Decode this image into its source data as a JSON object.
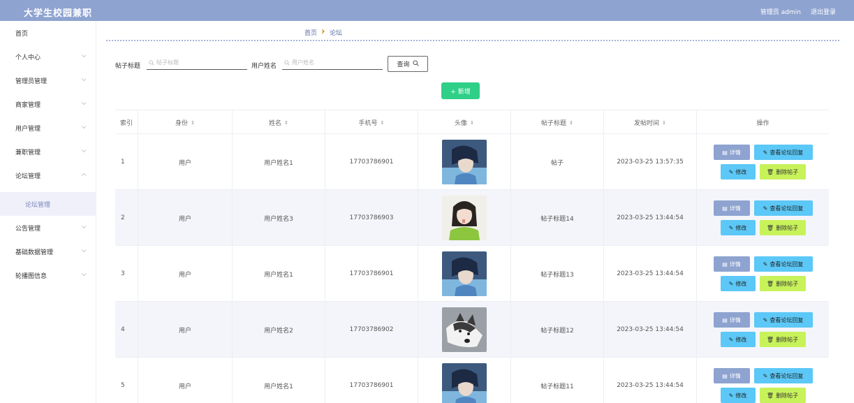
{
  "header": {
    "title": "大学生校园兼职",
    "user": "管理员 admin",
    "logout": "退出登录"
  },
  "sidebar": {
    "items": [
      {
        "label": "首页"
      },
      {
        "label": "个人中心"
      },
      {
        "label": "管理员管理"
      },
      {
        "label": "商家管理"
      },
      {
        "label": "用户管理"
      },
      {
        "label": "兼职管理"
      },
      {
        "label": "论坛管理"
      },
      {
        "label": "公告管理"
      },
      {
        "label": "基础数据管理"
      },
      {
        "label": "轮播图信息"
      }
    ],
    "active_sub": "论坛管理"
  },
  "breadcrumb": {
    "home": "首页",
    "current": "论坛"
  },
  "search": {
    "title_label": "帖子标题",
    "title_placeholder": "帖子标题",
    "user_label": "用户姓名",
    "user_placeholder": "用户姓名",
    "query_label": "查询"
  },
  "toolbar": {
    "add_label": "+ 新增"
  },
  "table": {
    "headers": [
      "索引",
      "身份",
      "姓名",
      "手机号",
      "头像",
      "帖子标题",
      "发帖时间",
      "操作"
    ],
    "rows": [
      {
        "index": "1",
        "role": "用户",
        "name": "用户姓名1",
        "phone": "17703786901",
        "avatar": "anime-boy",
        "title": "帖子",
        "time": "2023-03-25 13:57:35"
      },
      {
        "index": "2",
        "role": "用户",
        "name": "用户姓名3",
        "phone": "17703786903",
        "avatar": "girl-photo",
        "title": "帖子标题14",
        "time": "2023-03-25 13:44:54"
      },
      {
        "index": "3",
        "role": "用户",
        "name": "用户姓名1",
        "phone": "17703786901",
        "avatar": "anime-boy",
        "title": "帖子标题13",
        "time": "2023-03-25 13:44:54"
      },
      {
        "index": "4",
        "role": "用户",
        "name": "用户姓名2",
        "phone": "17703786902",
        "avatar": "husky-dog",
        "title": "帖子标题12",
        "time": "2023-03-25 13:44:54"
      },
      {
        "index": "5",
        "role": "用户",
        "name": "用户姓名1",
        "phone": "17703786901",
        "avatar": "anime-boy",
        "title": "帖子标题11",
        "time": "2023-03-25 13:44:54"
      }
    ],
    "actions": {
      "detail": "详情",
      "reply": "查看论坛回复",
      "edit": "修改",
      "delete": "删除帖子"
    }
  },
  "colors": {
    "header_bg": "#8ea3d0",
    "add_button": "#2fcf88",
    "detail_button": "#8ea3d0",
    "reply_button": "#5bc8f7",
    "delete_button": "#c8f25a"
  }
}
